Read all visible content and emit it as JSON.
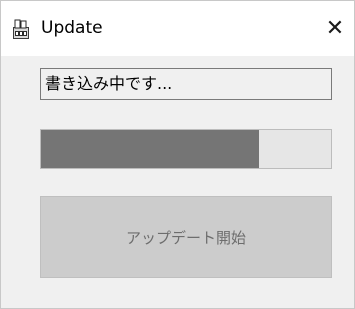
{
  "window": {
    "title": "Update",
    "close_glyph": "✕",
    "app_icon": "installer-package-icon"
  },
  "status": {
    "text": "書き込み中です..."
  },
  "progress": {
    "value_percent": 75,
    "fill_color": "#757575",
    "track_color": "#e6e6e6"
  },
  "actions": {
    "start_label": "アップデート開始",
    "start_enabled": false
  }
}
